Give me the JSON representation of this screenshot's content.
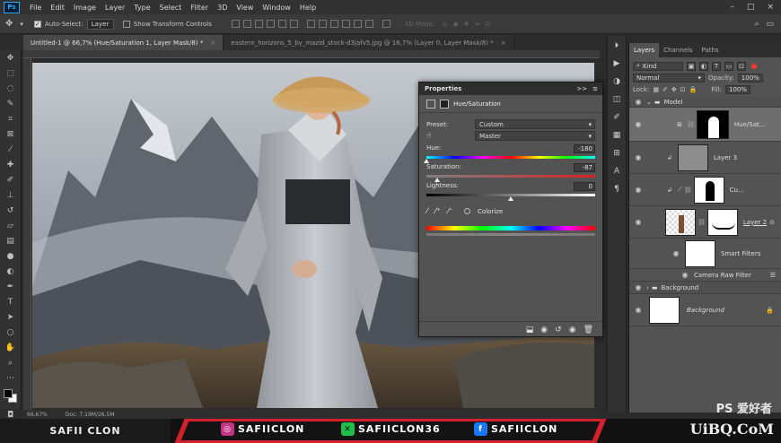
{
  "menubar": {
    "logo": "Ps",
    "items": [
      "File",
      "Edit",
      "Image",
      "Layer",
      "Type",
      "Select",
      "Filter",
      "3D",
      "View",
      "Window",
      "Help"
    ],
    "window_controls": [
      "–",
      "□",
      "×"
    ]
  },
  "options": {
    "auto_select_label": "Auto-Select:",
    "auto_select_target": "Layer",
    "show_transform_label": "Show Transform Controls",
    "mode_3d": "3D Mode:"
  },
  "tabs": [
    {
      "label": "Untitled-1 @ 66,7% (Hue/Saturation 1, Layer Mask/8) *",
      "close": "×"
    },
    {
      "label": "eastern_horizons_5_by_mazid_stock-d3jafv5.jpg @ 16,7% (Layer 0, Layer Mask/8) *",
      "close": "×"
    }
  ],
  "status": {
    "zoom": "66,67%",
    "doc": "Doc: 7,19M/26,5M"
  },
  "properties": {
    "title": "Properties",
    "collapse": ">>",
    "menu": "≡",
    "adjustment": "Hue/Saturation",
    "preset_label": "Preset:",
    "preset_value": "Custom",
    "channel_value": "Master",
    "hue_label": "Hue:",
    "hue_value": "-180",
    "hue_fraction": 0.0,
    "saturation_label": "Saturation:",
    "saturation_value": "-87",
    "saturation_fraction": 0.065,
    "lightness_label": "Lightness:",
    "lightness_value": "0",
    "lightness_fraction": 0.5,
    "colorize_label": "Colorize"
  },
  "layers_panel": {
    "tabs": [
      "Layers",
      "Channels",
      "Paths"
    ],
    "filter_kind": "Kind",
    "blend_mode": "Normal",
    "opacity_label": "Opacity:",
    "opacity_value": "100%",
    "lock_label": "Lock:",
    "fill_label": "Fill:",
    "fill_value": "100%",
    "layers": [
      {
        "name": "Model",
        "kind": "group"
      },
      {
        "name": "Hue/Sat...",
        "kind": "adjustment"
      },
      {
        "name": "Layer 3",
        "kind": "layer"
      },
      {
        "name": "Cu...",
        "kind": "curves"
      },
      {
        "name": "Layer 2",
        "kind": "smart"
      },
      {
        "name": "Smart Filters",
        "kind": "filters"
      },
      {
        "name": "Camera Raw Filter",
        "kind": "filter"
      },
      {
        "name": "Background",
        "kind": "group"
      },
      {
        "name": "Background",
        "kind": "background"
      }
    ]
  },
  "banner": {
    "name": "SAFII CLON",
    "instagram": "SAFIICLON",
    "other": "SAFIICLON36",
    "facebook": "SAFIICLON",
    "watermark": "UiBQ.CoM",
    "watermark_top": "PS 爱好者"
  },
  "colors": {
    "accent": "#31a8ff",
    "banner_red": "#d3202d",
    "panel": "#535353",
    "instagram": "#c13584",
    "facebook": "#1877f2",
    "green": "#1fbf4a"
  }
}
